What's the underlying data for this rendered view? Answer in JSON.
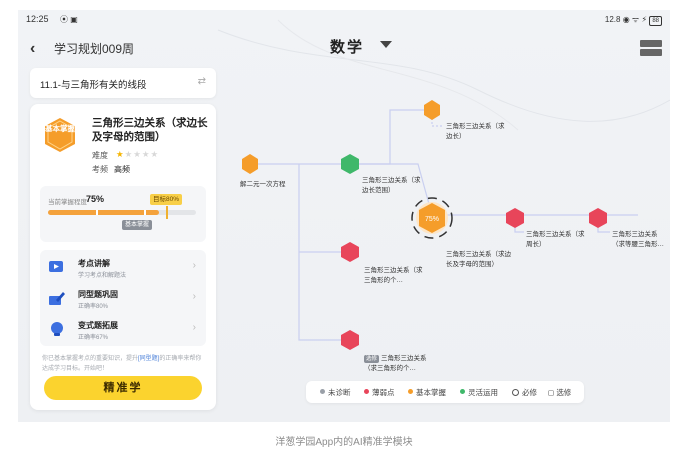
{
  "status_bar": {
    "time": "12:25",
    "signal_speed": "12.8",
    "battery": "88"
  },
  "header": {
    "back_icon": "chevron-left-icon",
    "plan_title": "学习规划009周",
    "subject": "数学"
  },
  "section": {
    "title": "11.1-与三角形有关的线段"
  },
  "knowledge_card": {
    "badge": "基本掌握",
    "title": "三角形三边关系（求边长及字母的范围）",
    "difficulty_label": "难度",
    "difficulty_stars": 1,
    "difficulty_max": 5,
    "frequency_label": "考频",
    "frequency_value": "高频",
    "mastery_label": "当前掌握程度",
    "mastery_value": "75%",
    "mastery_progress": 0.75,
    "goal_label": "目标80%",
    "goal_progress": 0.8,
    "level_tag": "基本掌握"
  },
  "actions": [
    {
      "title": "考点讲解",
      "subtitle": "学习考点和解题法",
      "icon": "video-icon"
    },
    {
      "title": "同型题巩固",
      "subtitle": "正确率80%",
      "icon": "pencil-icon"
    },
    {
      "title": "变式题拓展",
      "subtitle": "正确率67%",
      "icon": "bulb-icon"
    }
  ],
  "hint": {
    "before": "你已基本掌握考点的重要知识，提升",
    "link": "[同型题]",
    "after": "的正确率来帮你达成学习目标。开始吧！"
  },
  "start_button": "精准学",
  "map": {
    "center_value": "75%",
    "nodes": [
      {
        "id": "n1",
        "label": "解二元一次方程",
        "color": "#f59d2a"
      },
      {
        "id": "n2",
        "label": "三角形三边关系（求边长范围）",
        "color": "#3fb86a"
      },
      {
        "id": "n3",
        "label": "三角形三边关系（求边长）",
        "color": "#f59d2a"
      },
      {
        "id": "n4",
        "label": "三角形三边关系（求边长及字母的范围）",
        "color": "#f59d2a"
      },
      {
        "id": "n5",
        "label": "三角形三边关系（求周长）",
        "color": "#e8455a"
      },
      {
        "id": "n6",
        "label": "三角形三边关系（求等腰三角形…",
        "color": "#e8455a"
      },
      {
        "id": "n7",
        "label": "三角形三边关系（求三角形的个…",
        "color": "#e8455a"
      },
      {
        "id": "n8",
        "label": "三角形三边关系（求三角形的个…",
        "color": "#e8455a",
        "tag": "选修"
      }
    ]
  },
  "legend": [
    {
      "label": "未诊断",
      "color": "#9aa0a8",
      "kind": "dot"
    },
    {
      "label": "薄弱点",
      "color": "#e8455a",
      "kind": "dot"
    },
    {
      "label": "基本掌握",
      "color": "#f59d2a",
      "kind": "dot"
    },
    {
      "label": "灵活运用",
      "color": "#3fb86a",
      "kind": "dot"
    },
    {
      "label": "必修",
      "kind": "ring"
    },
    {
      "label": "选修",
      "kind": "dashed"
    }
  ],
  "caption": "洋葱学园App内的AI精准学模块"
}
